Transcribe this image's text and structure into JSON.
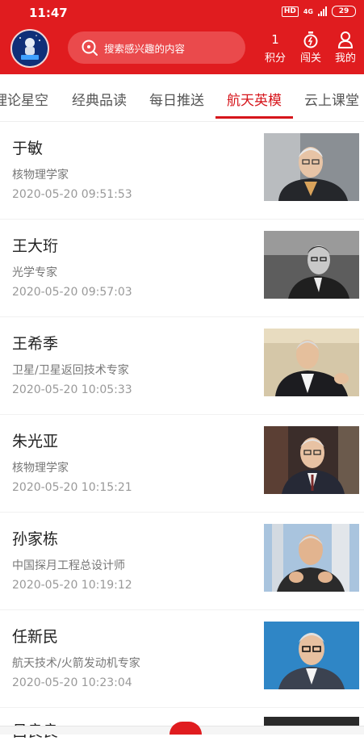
{
  "status_bar": {
    "time": "11:47",
    "hd": "HD",
    "network": "4G",
    "battery": "29"
  },
  "header": {
    "logo_alt": "我们的太空",
    "search_placeholder": "搜索感兴趣的内容",
    "points_value": "1",
    "points_label": "积分",
    "challenge_label": "闯关",
    "mine_label": "我的"
  },
  "tabs": [
    {
      "label": "理论星空"
    },
    {
      "label": "经典品读"
    },
    {
      "label": "每日推送"
    },
    {
      "label": "航天英模",
      "active": true
    },
    {
      "label": "云上课堂"
    }
  ],
  "items": [
    {
      "name": "于敏",
      "desc": "核物理学家",
      "date": "2020-05-20 09:51:53"
    },
    {
      "name": "王大珩",
      "desc": "光学专家",
      "date": "2020-05-20 09:57:03"
    },
    {
      "name": "王希季",
      "desc": "卫星/卫星返回技术专家",
      "date": "2020-05-20 10:05:33"
    },
    {
      "name": "朱光亚",
      "desc": "核物理学家",
      "date": "2020-05-20 10:15:21"
    },
    {
      "name": "孙家栋",
      "desc": "中国探月工程总设计师",
      "date": "2020-05-20 10:19:12"
    },
    {
      "name": "任新民",
      "desc": "航天技术/火箭发动机专家",
      "date": "2020-05-20 10:23:04"
    }
  ],
  "partial_item": {
    "name": "吕良良"
  },
  "colors": {
    "brand_red": "#e01c1f",
    "active_tab": "#d6151b"
  }
}
